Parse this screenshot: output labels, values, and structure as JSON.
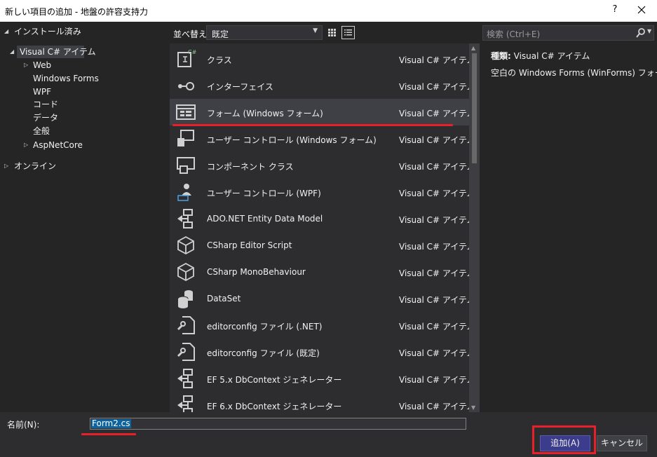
{
  "window": {
    "title": "新しい項目の追加 - 地盤の許容支持力",
    "help_label": "?",
    "close_icon": "close-icon"
  },
  "tree": {
    "installed": "インストール済み",
    "visual_csharp": "Visual C# アイテム",
    "web": "Web",
    "windows_forms": "Windows Forms",
    "wpf": "WPF",
    "code": "コード",
    "data": "データ",
    "general": "全般",
    "aspnetcore": "AspNetCore",
    "online": "オンライン"
  },
  "toolbar": {
    "sort_label": "並べ替え:",
    "sort_value": "既定",
    "grid_view_icon": "grid-view-icon",
    "list_view_icon": "list-view-icon"
  },
  "items": [
    {
      "name": "クラス",
      "type": "Visual C# アイテム",
      "icon": "class-icon"
    },
    {
      "name": "インターフェイス",
      "type": "Visual C# アイテム",
      "icon": "interface-icon"
    },
    {
      "name": "フォーム (Windows フォーム)",
      "type": "Visual C# アイテム",
      "icon": "form-icon",
      "selected": true
    },
    {
      "name": "ユーザー コントロール (Windows フォーム)",
      "type": "Visual C# アイテム",
      "icon": "user-control-icon"
    },
    {
      "name": "コンポーネント クラス",
      "type": "Visual C# アイテム",
      "icon": "component-class-icon"
    },
    {
      "name": "ユーザー コントロール (WPF)",
      "type": "Visual C# アイテム",
      "icon": "wpf-user-control-icon"
    },
    {
      "name": "ADO.NET Entity Data Model",
      "type": "Visual C# アイテム",
      "icon": "entity-model-icon"
    },
    {
      "name": "CSharp Editor Script",
      "type": "Visual C# アイテム",
      "icon": "cube-icon"
    },
    {
      "name": "CSharp MonoBehaviour",
      "type": "Visual C# アイテム",
      "icon": "cube-icon"
    },
    {
      "name": "DataSet",
      "type": "Visual C# アイテム",
      "icon": "dataset-icon"
    },
    {
      "name": "editorconfig ファイル (.NET)",
      "type": "Visual C# アイテム",
      "icon": "config-file-icon"
    },
    {
      "name": "editorconfig ファイル (既定)",
      "type": "Visual C# アイテム",
      "icon": "config-file-icon"
    },
    {
      "name": "EF 5.x DbContext ジェネレーター",
      "type": "Visual C# アイテム",
      "icon": "generator-icon"
    },
    {
      "name": "EF 6.x DbContext ジェネレーター",
      "type": "Visual C# アイテム",
      "icon": "generator-icon"
    }
  ],
  "search": {
    "placeholder": "検索 (Ctrl+E)"
  },
  "details": {
    "type_label": "種類:",
    "type_value": "Visual C# アイテム",
    "description": "空白の Windows Forms (WinForms) フォーム"
  },
  "bottom": {
    "name_label": "名前(N):",
    "name_value": "Form2.cs",
    "add_label": "追加(A)",
    "cancel_label": "キャンセル"
  },
  "colors": {
    "background": "#252526",
    "list_background": "#2d2d30",
    "selected": "#3f3f46",
    "primary_button": "#3c3c8c",
    "annotation_red": "#e8202a"
  }
}
